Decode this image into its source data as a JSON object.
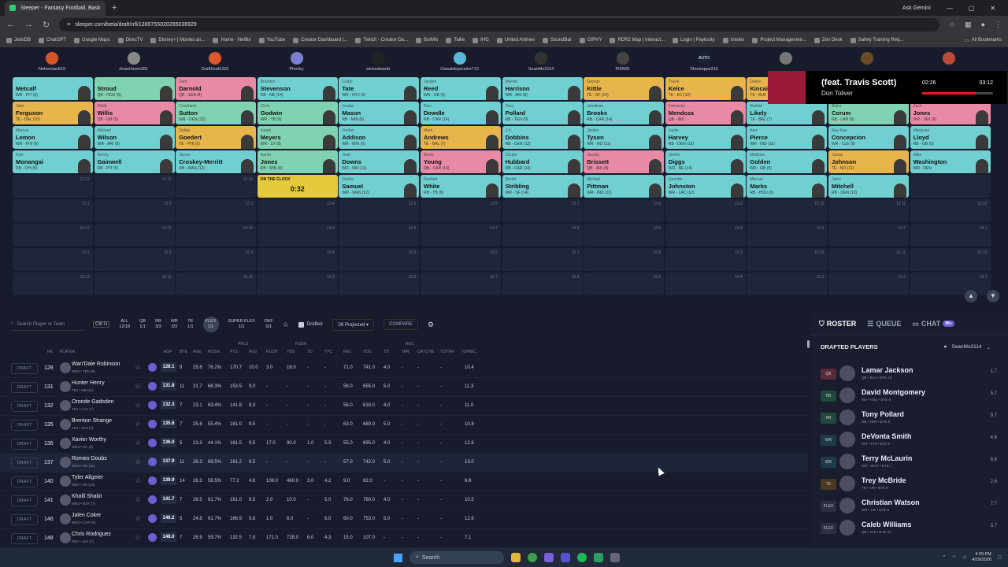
{
  "browser": {
    "tab_title": "Sleeper - Fantasy Football, Bask",
    "url": "sleeper.com/beta/draft/nfl/1389755020295036929",
    "gemini": "Ask Gemini",
    "bookmarks": [
      "JobsDB",
      "ChatGPT",
      "Google Maps",
      "DirecTV",
      "Disney+ | Movies an...",
      "Home - Netflix",
      "YouTube",
      "Creator Dashboard |...",
      "Twitch - Creator Da...",
      "BotMix",
      "Tallie",
      "IHG",
      "United Airlines",
      "SoundBar",
      "GIPHY",
      "RDR2 Map | Interact...",
      "Login | Paylocity",
      "Intelex",
      "Project Managemen...",
      "Zen Desk",
      "Safety Training Req..."
    ],
    "all_bookmarks": "All Bookmarks"
  },
  "teams": [
    "Nehemias919",
    "Jmachtown281",
    "DraftGod1226",
    "Phonky",
    "wickedworld",
    "Oswaldoperales713",
    "SeanMo2114",
    "P00MS",
    "Shootopps316",
    "",
    "",
    ""
  ],
  "auto_label": "AUTO",
  "board": [
    [
      "wr",
      "",
      "Metcalf",
      "WR - PIT (5)"
    ],
    [
      "rb",
      "",
      "Stroud",
      "QB - HOU (6)"
    ],
    [
      "qb",
      "Sam",
      "Darnold",
      "QB - SEA (8)"
    ],
    [
      "wr",
      "Brandon",
      "Stevenson",
      "RB - NE (14)"
    ],
    [
      "wr",
      "Caleb",
      "Tate",
      "WR - NYJ (9)"
    ],
    [
      "wr",
      "Jayden",
      "Reed",
      "WR - GB (5)"
    ],
    [
      "wr",
      "Marvin",
      "Harrison",
      "WR - ARI (8)"
    ],
    [
      "te",
      "George",
      "Kittle",
      "TE - SF (14)"
    ],
    [
      "te",
      "Travis",
      "Kelce",
      "TE - KC (10)"
    ],
    [
      "te",
      "Dalton",
      "Kincaid",
      "TE - BUF (7)"
    ],
    [
      "",
      "",
      "",
      ""
    ],
    [
      "",
      "",
      "",
      ""
    ],
    [
      "te",
      "Jake",
      "Ferguson",
      "TE - DAL (10)"
    ],
    [
      "qb",
      "Malik",
      "Willis",
      "QB - GB (5)"
    ],
    [
      "rb",
      "Courtland",
      "Sutton",
      "WR - DEN (12)"
    ],
    [
      "rb",
      "Chris",
      "Godwin",
      "WR - TB (9)"
    ],
    [
      "wr",
      "Jordan",
      "Mason",
      "RB - MIN (6)"
    ],
    [
      "wr",
      "Rico",
      "Dowdle",
      "RB - CAR (14)"
    ],
    [
      "wr",
      "Tony",
      "Pollard",
      "RB - TEN (9)"
    ],
    [
      "wr",
      "Jonathan",
      "Brooks",
      "RB - CAR (14)"
    ],
    [
      "qb",
      "Fernando",
      "Mendoza",
      "QB - IND"
    ],
    [
      "wr",
      "Rashid",
      "Likely",
      "TE - BAL (7)"
    ],
    [
      "rb",
      "Blake",
      "Corum",
      "RB - LAR (8)"
    ],
    [
      "qb",
      "Zach",
      "Jones",
      "WR - JAX (8)"
    ],
    [
      "wr",
      "Marcus",
      "Lemon",
      "WR - PHI (9)"
    ],
    [
      "wr",
      "Michael",
      "Wilson",
      "WR - ARI (8)"
    ],
    [
      "te",
      "Dallas",
      "Goedert",
      "TE - PHI (9)"
    ],
    [
      "rb",
      "Isaiah",
      "Meyers",
      "WR - LV (8)"
    ],
    [
      "wr",
      "Jordan",
      "Addison",
      "WR - MIN (6)"
    ],
    [
      "te",
      "Mark",
      "Andrews",
      "TE - BAL (7)"
    ],
    [
      "wr",
      "J.K.",
      "Dobbins",
      "RB - DEN (12)"
    ],
    [
      "wr",
      "Jordan",
      "Tyson",
      "WR - NO (11)"
    ],
    [
      "wr",
      "Jaylin",
      "Harvey",
      "RB - DEN (12)"
    ],
    [
      "wr",
      "Alec",
      "Pierce",
      "WR - IND (11)"
    ],
    [
      "wr",
      "Ray-Ray",
      "Concepcion",
      "WR - CLE (9)"
    ],
    [
      "wr",
      "Marquise",
      "Lloyd",
      "RB - GB (5)"
    ],
    [
      "wr",
      "Kyle",
      "Monangai",
      "RB - CHI (5)"
    ],
    [
      "wr",
      "Kenny",
      "Gainwell",
      "RB - PIT (5)"
    ],
    [
      "wr",
      "Jacory",
      "Croskey-Merritt",
      "RB - WAS (12)"
    ],
    [
      "rb",
      "Aaron",
      "Jones",
      "RB - MIN (6)"
    ],
    [
      "wr",
      "Josh",
      "Downs",
      "WR - IND (11)"
    ],
    [
      "qb",
      "Bryce",
      "Young",
      "QB - CAR (14)"
    ],
    [
      "wr",
      "Chuba",
      "Hubbard",
      "RB - CAR (14)"
    ],
    [
      "qb",
      "Jacoby",
      "Brissett",
      "QB - ARI (8)"
    ],
    [
      "wr",
      "Stefon",
      "Diggs",
      "WR - NE (14)"
    ],
    [
      "wr",
      "Matthew",
      "Golden",
      "WR - GB (5)"
    ],
    [
      "te",
      "Juwan",
      "Johnson",
      "TE - NO (11)"
    ],
    [
      "wr",
      "Mike",
      "Washington",
      "WR - DEN"
    ],
    [
      "",
      "",
      "",
      "12.12"
    ],
    [
      "",
      "",
      "",
      "12.11"
    ],
    [
      "",
      "",
      "",
      "12.10"
    ],
    [
      "clock",
      "ON THE CLOCK",
      "0:32",
      ""
    ],
    [
      "wr",
      "Deebo",
      "Samuel",
      "WR - WAS (12)"
    ],
    [
      "wr",
      "Rashod",
      "White",
      "RB - TB (9)"
    ],
    [
      "wr",
      "Dont'e",
      "Stribling",
      "WR - SF (14)"
    ],
    [
      "wr",
      "Michael",
      "Pittman",
      "WR - IND (11)"
    ],
    [
      "wr",
      "Quentin",
      "Johnston",
      "WR - LAC (12)"
    ],
    [
      "wr",
      "Marcus",
      "Marks",
      "RB - HOU (6)"
    ],
    [
      "wr",
      "Jalen",
      "Mitchell",
      "RB - DEN (12)"
    ],
    [
      "",
      "",
      "",
      ""
    ],
    [
      "",
      "",
      "",
      "13.1"
    ],
    [
      "",
      "",
      "",
      "13.2"
    ],
    [
      "",
      "",
      "",
      "13.3"
    ],
    [
      "",
      "",
      "",
      "13.4"
    ],
    [
      "",
      "",
      "",
      "13.5"
    ],
    [
      "",
      "",
      "",
      "13.6"
    ],
    [
      "",
      "",
      "",
      "13.7"
    ],
    [
      "",
      "",
      "",
      "13.8"
    ],
    [
      "",
      "",
      "",
      "13.9"
    ],
    [
      "",
      "",
      "",
      "13.10"
    ],
    [
      "",
      "",
      "",
      "13.11"
    ],
    [
      "",
      "",
      "",
      "13.12"
    ],
    [
      "",
      "",
      "",
      "14.12"
    ],
    [
      "",
      "",
      "",
      "14.11"
    ],
    [
      "",
      "",
      "",
      "14.10"
    ],
    [
      "",
      "",
      "",
      "14.9"
    ],
    [
      "",
      "",
      "",
      "14.8"
    ],
    [
      "",
      "",
      "",
      "14.7"
    ],
    [
      "",
      "",
      "",
      "14.6"
    ],
    [
      "",
      "",
      "",
      "14.5"
    ],
    [
      "",
      "",
      "",
      "14.4"
    ],
    [
      "",
      "",
      "",
      "14.3"
    ],
    [
      "",
      "",
      "",
      "14.2"
    ],
    [
      "",
      "",
      "",
      "14.1"
    ],
    [
      "",
      "",
      "",
      "15.1"
    ],
    [
      "",
      "",
      "",
      "15.2"
    ],
    [
      "",
      "",
      "",
      "15.3"
    ],
    [
      "",
      "",
      "",
      "15.4"
    ],
    [
      "",
      "",
      "",
      "15.5"
    ],
    [
      "",
      "",
      "",
      "15.6"
    ],
    [
      "",
      "",
      "",
      "15.7"
    ],
    [
      "",
      "",
      "",
      "15.8"
    ],
    [
      "",
      "",
      "",
      "15.9"
    ],
    [
      "",
      "",
      "",
      "15.10"
    ],
    [
      "",
      "",
      "",
      "15.11"
    ],
    [
      "",
      "",
      "",
      "15.12"
    ],
    [
      "",
      "",
      "",
      "16.12"
    ],
    [
      "",
      "",
      "",
      "16.11"
    ],
    [
      "",
      "",
      "",
      "16.10"
    ],
    [
      "",
      "",
      "",
      "16.9"
    ],
    [
      "",
      "",
      "",
      "16.8"
    ],
    [
      "",
      "",
      "",
      "16.7"
    ],
    [
      "",
      "",
      "",
      "16.6"
    ],
    [
      "",
      "",
      "",
      "16.5"
    ],
    [
      "",
      "",
      "",
      "16.4"
    ],
    [
      "",
      "",
      "",
      "16.3"
    ],
    [
      "",
      "",
      "",
      "16.2"
    ],
    [
      "",
      "",
      "",
      "16.1"
    ]
  ],
  "music": {
    "song": "(feat. Travis Scott)",
    "artist": "Don Toliver",
    "elapsed": "02:26",
    "total": "03:12",
    "progress": 0.76
  },
  "filters": {
    "search_placeholder": "Search Player or Team",
    "shortcut": "Ctrl U",
    "positions": [
      [
        "ALL",
        "12/18"
      ],
      [
        "QB",
        "1/1"
      ],
      [
        "RB",
        "3/3"
      ],
      [
        "WR",
        "3/3"
      ],
      [
        "TE",
        "1/1"
      ],
      [
        "FLEX",
        "1/1"
      ],
      [
        "SUPER FLEX",
        "1/1"
      ],
      [
        "DEF",
        "0/1"
      ]
    ],
    "drafted": "Drafted",
    "projected": "'26 Projected",
    "compare": "COMPARE"
  },
  "headers": {
    "groups": [
      "PROJ",
      "RUSH",
      "REC"
    ],
    "cols": [
      "RK",
      "PLAYER",
      "ADP",
      "BYE",
      "AGE",
      "ROS%",
      "PTS",
      "AVG",
      "RUSH",
      "YDS",
      "TD",
      "YPC",
      "REC",
      "YDS",
      "TD",
      "TAR",
      "CATCH%",
      "YD/TAR",
      "YD/REC"
    ]
  },
  "draft_label": "DRAFT",
  "players": [
    [
      "128",
      "Wan'Dale Robinson",
      "WR3 • TEN (9)",
      "128.1",
      "9",
      "25.6",
      "76.2%",
      "170.7",
      "10.0",
      "3.0",
      "16.0",
      "-",
      "-",
      "71.0",
      "741.0",
      "4.0",
      "-",
      "-",
      "-",
      "10.4"
    ],
    [
      "131",
      "Hunter Henry",
      "TE1 • NE (11)",
      "131.8",
      "11",
      "31.7",
      "66.3%",
      "153.5",
      "9.0",
      "-",
      "-",
      "-",
      "-",
      "58.0",
      "655.0",
      "5.0",
      "-",
      "-",
      "-",
      "11.3"
    ],
    [
      "132",
      "Oronde Gadsden",
      "TE1 • LAC (7)",
      "132.3",
      "7",
      "23.1",
      "63.4%",
      "141.8",
      "8.3",
      "-",
      "-",
      "-",
      "-",
      "56.0",
      "618.0",
      "4.0",
      "-",
      "-",
      "-",
      "11.0"
    ],
    [
      "135",
      "Brenton Strange",
      "TE1 • JAX (7)",
      "135.6",
      "7",
      "25.6",
      "55.4%",
      "161.0",
      "9.5",
      "-",
      "-",
      "-",
      "-",
      "63.0",
      "680.0",
      "5.0",
      "-",
      "-",
      "-",
      "10.8"
    ],
    [
      "136",
      "Xavier Worthy",
      "WR3 • KC (6)",
      "136.0",
      "5",
      "23.3",
      "44.1%",
      "161.5",
      "9.5",
      "17.0",
      "90.0",
      "1.0",
      "5.3",
      "55.0",
      "695.0",
      "4.0",
      "-",
      "-",
      "-",
      "12.6"
    ],
    [
      "137",
      "Romeo Doubs",
      "WR3 • NE (11)",
      "137.9",
      "11",
      "26.3",
      "69.5%",
      "161.2",
      "9.5",
      "-",
      "-",
      "-",
      "-",
      "57.0",
      "742.0",
      "5.0",
      "-",
      "-",
      "-",
      "13.0"
    ],
    [
      "140",
      "Tyler Allgeier",
      "RB2 • ARI (14)",
      "139.9",
      "14",
      "26.3",
      "58.5%",
      "77.2",
      "4.8",
      "109.0",
      "460.0",
      "3.0",
      "4.2",
      "9.0",
      "62.0",
      "-",
      "-",
      "-",
      "-",
      "6.9"
    ],
    [
      "141",
      "Khalil Shakir",
      "WR3 • BUF (7)",
      "141.7",
      "7",
      "26.5",
      "61.7%",
      "161.0",
      "9.5",
      "2.0",
      "10.0",
      "-",
      "5.0",
      "76.0",
      "760.0",
      "4.0",
      "-",
      "-",
      "-",
      "10.5"
    ],
    [
      "146",
      "Jalen Coker",
      "WR3 • CAR (5)",
      "146.2",
      "5",
      "24.8",
      "61.7%",
      "166.9",
      "9.8",
      "1.0",
      "6.0",
      "-",
      "6.0",
      "60.0",
      "753.0",
      "5.0",
      "-",
      "-",
      "-",
      "12.6"
    ],
    [
      "148",
      "Chris Rodriguez",
      "RB2 • JAX (7)",
      "148.0",
      "7",
      "26.9",
      "59.7%",
      "132.5",
      "7.8",
      "171.0",
      "728.0",
      "6.0",
      "4.3",
      "15.0",
      "107.0",
      "-",
      "-",
      "-",
      "-",
      "7.1"
    ]
  ],
  "right": {
    "tabs": [
      "ROSTER",
      "QUEUE",
      "CHAT"
    ],
    "chat_badge": "99+",
    "drafted_title": "DRAFTED PLAYERS",
    "user": "SeanMo2114",
    "roster": [
      [
        "QB",
        "Lamar Jackson",
        "QB • BAL • BYE 13",
        "1.7"
      ],
      [
        "RB",
        "David Montgomery",
        "RB • HOU • BYE 8",
        "5.7"
      ],
      [
        "RB",
        "Tony Pollard",
        "RB • TEN • BYE 9",
        "9.7"
      ],
      [
        "WR",
        "DeVonta Smith",
        "WR • PHI • BYE 9",
        "4.6"
      ],
      [
        "WR",
        "Terry McLaurin",
        "WR • WAS • BYE 7",
        "6.6"
      ],
      [
        "TE",
        "Trey McBride",
        "TE • ARI • BYE 8",
        "2.6"
      ],
      [
        "FLEX",
        "Christian Watson",
        "WR • GB • BYE 5",
        "7.7"
      ],
      [
        "FLEX",
        "Caleb Williams",
        "QB • CHI • BYE 10",
        "3.7"
      ]
    ]
  },
  "taskbar": {
    "search": "Search",
    "time": "4:09 PM",
    "date": "4/29/2026"
  }
}
